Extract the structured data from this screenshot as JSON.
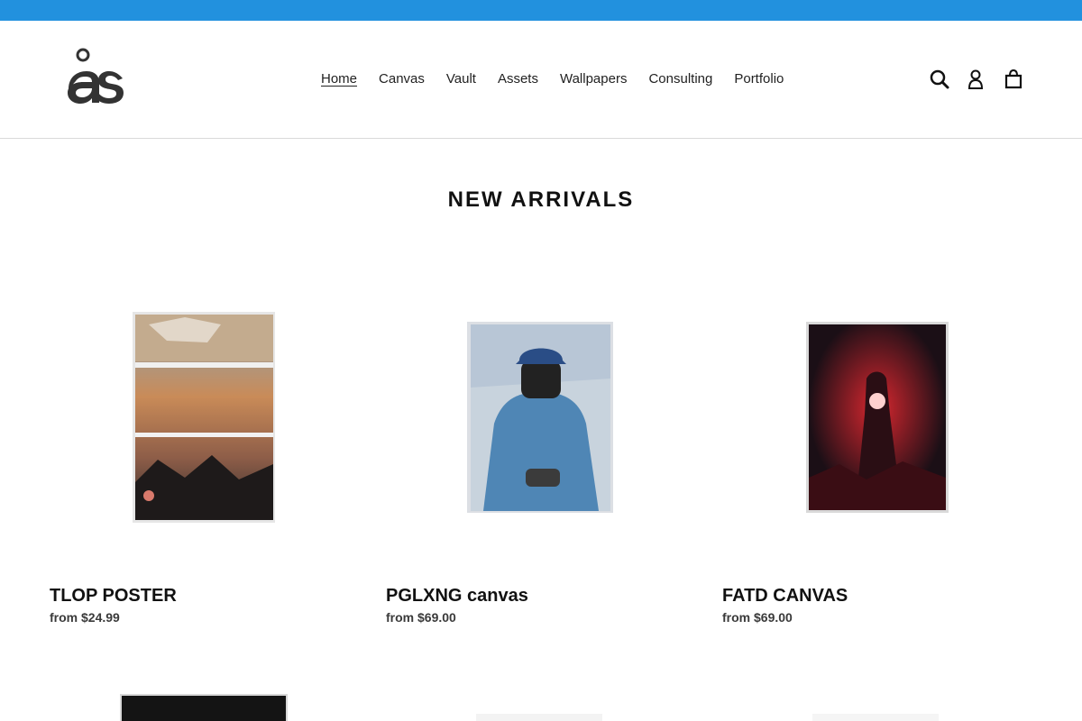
{
  "brand": {
    "logo_icon": "as-monogram-logo",
    "announcement_color": "#2291de"
  },
  "nav": {
    "items": [
      {
        "label": "Home",
        "active": true
      },
      {
        "label": "Canvas"
      },
      {
        "label": "Vault"
      },
      {
        "label": "Assets"
      },
      {
        "label": "Wallpapers"
      },
      {
        "label": "Consulting"
      },
      {
        "label": "Portfolio"
      }
    ]
  },
  "header_icons": [
    "search-icon",
    "account-icon",
    "cart-icon"
  ],
  "collection": {
    "title": "NEW ARRIVALS",
    "products": [
      {
        "title": "TLOP POSTER",
        "price": "from $24.99"
      },
      {
        "title": "PGLXNG canvas",
        "price": "from $69.00"
      },
      {
        "title": "FATD CANVAS",
        "price": "from $69.00"
      }
    ]
  }
}
